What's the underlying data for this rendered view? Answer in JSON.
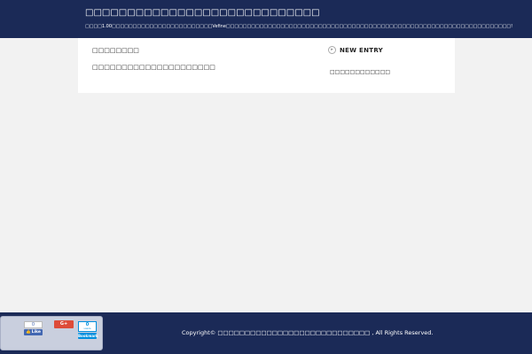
{
  "header": {
    "site_title": "□□□□□□□□□□□□□□□□□□□□□□□□□□□□",
    "site_description": "□□□□1.00□□□□□□□□□□□□□□□□□□□□□□□□Vefine□□□□□□□□□□□□□□□□□□□□□□□□□□□□□□□□□□□□□□□□□□□□□□□□□□□□□□□□□□□□□□□□□□□□!"
  },
  "article": {
    "title": "□□□□□□□□",
    "body": "□□□□□□□□□□□□□□□□□□□□□"
  },
  "sidebar": {
    "new_entry_icon": "arrow-circle-icon",
    "new_entry_title": "NEW ENTRY",
    "items": [
      "□□□□□□□□□□□□"
    ]
  },
  "footer": {
    "copyright": "Copyright© □□□□□□□□□□□□□□□□□□□□□□□□□□□□ , All Rights Reserved."
  },
  "share": {
    "facebook": {
      "count": "0",
      "label": "Like"
    },
    "google_plus": {
      "label": "G+"
    },
    "hatena": {
      "count": "0",
      "unit": "users",
      "label": "Bookmark"
    },
    "colors": {
      "facebook": "#4267b2",
      "google_plus": "#dd4b39",
      "hatena": "#008fde"
    }
  },
  "colors": {
    "header_bg": "#1b2a57",
    "footer_bg": "#1b2a57",
    "page_bg": "#f2f2f2"
  }
}
